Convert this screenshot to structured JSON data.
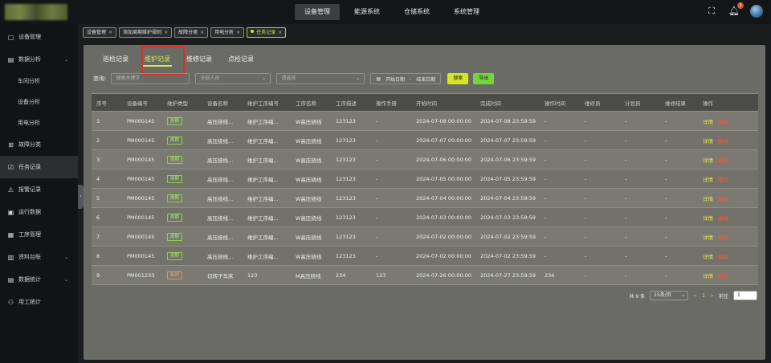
{
  "topnav": [
    {
      "label": "设备管理",
      "active": true
    },
    {
      "label": "能源系统",
      "active": false
    },
    {
      "label": "仓储系统",
      "active": false
    },
    {
      "label": "系统管理",
      "active": false
    }
  ],
  "notifications": {
    "count": "1"
  },
  "sidebar": [
    {
      "label": "设备管理",
      "icon": "monitor-icon",
      "sub": false,
      "expand": false
    },
    {
      "label": "数据分析",
      "icon": "chart-doc-icon",
      "sub": false,
      "expand": true
    },
    {
      "label": "车间分析",
      "sub": true
    },
    {
      "label": "设备分析",
      "sub": true
    },
    {
      "label": "用电分析",
      "sub": true
    },
    {
      "label": "故障分类",
      "icon": "fault-icon",
      "sub": false,
      "expand": false
    },
    {
      "label": "任务记录",
      "icon": "task-icon",
      "sub": false,
      "expand": false,
      "active": true
    },
    {
      "label": "报警记录",
      "icon": "alarm-icon",
      "sub": false,
      "expand": false
    },
    {
      "label": "运行数据",
      "icon": "data-icon",
      "sub": false,
      "expand": false
    },
    {
      "label": "工序管理",
      "icon": "process-icon",
      "sub": false,
      "expand": false
    },
    {
      "label": "资料台账",
      "icon": "ledger-icon",
      "sub": false,
      "expand": true
    },
    {
      "label": "数据统计",
      "icon": "stats-icon",
      "sub": false,
      "expand": true
    },
    {
      "label": "用工统计",
      "icon": "user-icon",
      "sub": false,
      "expand": false
    }
  ],
  "breadcrumbs": [
    {
      "label": "设备管理",
      "active": false
    },
    {
      "label": "添加周期维护规则",
      "active": false
    },
    {
      "label": "故障分类",
      "active": false
    },
    {
      "label": "用电分析",
      "active": false
    },
    {
      "label": "任务记录",
      "active": true
    }
  ],
  "tabs": [
    {
      "label": "巡检记录",
      "active": false
    },
    {
      "label": "维护记录",
      "active": true
    },
    {
      "label": "维修记录",
      "active": false
    },
    {
      "label": "点检记录",
      "active": false
    }
  ],
  "filters": {
    "label": "查询:",
    "keyword_placeholder": "搜索关键字",
    "person_placeholder": "全部人员",
    "select_placeholder": "请选择",
    "start_date": "开始日期",
    "date_sep": "-",
    "end_date": "结束日期",
    "search_label": "搜索",
    "export_label": "导出"
  },
  "table": {
    "headers": [
      "序号",
      "设备编号",
      "维护类型",
      "设备名称",
      "维护工序编号",
      "工序名称",
      "工序描述",
      "操作手册",
      "开始时间",
      "完成时间",
      "操作时间",
      "维修员",
      "计划员",
      "维修结果",
      "操作"
    ],
    "rows": [
      {
        "no": "1",
        "code": "PM000145",
        "type": "周期",
        "tagColor": "green",
        "name": "高压绕线...",
        "procNo": "维护工序编...",
        "procName": "W高压绕线",
        "desc": "123123",
        "manual": "-",
        "start": "2024-07-08 00:00:00",
        "finish": "2024-07-08 23:59:59",
        "opTime": "-",
        "repairer": "-",
        "planner": "-",
        "result": "-"
      },
      {
        "no": "2",
        "code": "PM000145",
        "type": "周期",
        "tagColor": "green",
        "name": "高压绕线...",
        "procNo": "维护工序编...",
        "procName": "W高压绕线",
        "desc": "123123",
        "manual": "-",
        "start": "2024-07-07 00:00:00",
        "finish": "2024-07-07 23:59:59",
        "opTime": "-",
        "repairer": "-",
        "planner": "-",
        "result": "-"
      },
      {
        "no": "3",
        "code": "PM000145",
        "type": "周期",
        "tagColor": "green",
        "name": "高压绕线...",
        "procNo": "维护工序编...",
        "procName": "W高压绕线",
        "desc": "123123",
        "manual": "-",
        "start": "2024-07-06 00:00:00",
        "finish": "2024-07-06 23:59:59",
        "opTime": "-",
        "repairer": "-",
        "planner": "-",
        "result": "-"
      },
      {
        "no": "4",
        "code": "PM000145",
        "type": "周期",
        "tagColor": "green",
        "name": "高压绕线...",
        "procNo": "维护工序编...",
        "procName": "W高压绕线",
        "desc": "123123",
        "manual": "-",
        "start": "2024-07-05 00:00:00",
        "finish": "2024-07-05 23:59:59",
        "opTime": "-",
        "repairer": "-",
        "planner": "-",
        "result": "-"
      },
      {
        "no": "5",
        "code": "PM000145",
        "type": "周期",
        "tagColor": "green",
        "name": "高压绕线...",
        "procNo": "维护工序编...",
        "procName": "W高压绕线",
        "desc": "123123",
        "manual": "-",
        "start": "2024-07-04 00:00:00",
        "finish": "2024-07-04 23:59:59",
        "opTime": "-",
        "repairer": "-",
        "planner": "-",
        "result": "-"
      },
      {
        "no": "6",
        "code": "PM000145",
        "type": "周期",
        "tagColor": "green",
        "name": "高压绕线...",
        "procNo": "维护工序编...",
        "procName": "W高压绕线",
        "desc": "123123",
        "manual": "-",
        "start": "2024-07-03 00:00:00",
        "finish": "2024-07-03 23:59:59",
        "opTime": "-",
        "repairer": "-",
        "planner": "-",
        "result": "-"
      },
      {
        "no": "7",
        "code": "PM000145",
        "type": "周期",
        "tagColor": "green",
        "name": "高压绕线...",
        "procNo": "维护工序编...",
        "procName": "W高压绕线",
        "desc": "123123",
        "manual": "-",
        "start": "2024-07-02 00:00:00",
        "finish": "2024-07-02 23:59:59",
        "opTime": "-",
        "repairer": "-",
        "planner": "-",
        "result": "-"
      },
      {
        "no": "8",
        "code": "PM000145",
        "type": "周期",
        "tagColor": "green",
        "name": "高压绕线...",
        "procNo": "维护工序编...",
        "procName": "W高压绕线",
        "desc": "123123",
        "manual": "-",
        "start": "2024-07-02 00:00:00",
        "finish": "2024-07-02 23:59:59",
        "opTime": "-",
        "repairer": "-",
        "planner": "-",
        "result": "-"
      },
      {
        "no": "9",
        "code": "PM001233",
        "type": "临时",
        "tagColor": "orange",
        "name": "切转子车床",
        "procNo": "123",
        "procName": "M高压绕线",
        "desc": "234",
        "manual": "123",
        "start": "2024-07-26 00:00:00",
        "finish": "2024-07-27 23:59:59",
        "opTime": "234",
        "repairer": "-",
        "planner": "-",
        "result": "-"
      }
    ],
    "action_detail": "详情",
    "action_delete": "删除"
  },
  "pager": {
    "total": "共 9 条",
    "page_size": "15条/页",
    "prev": "<",
    "current": "1",
    "next": ">",
    "goto_label": "前往",
    "goto_value": "1"
  }
}
